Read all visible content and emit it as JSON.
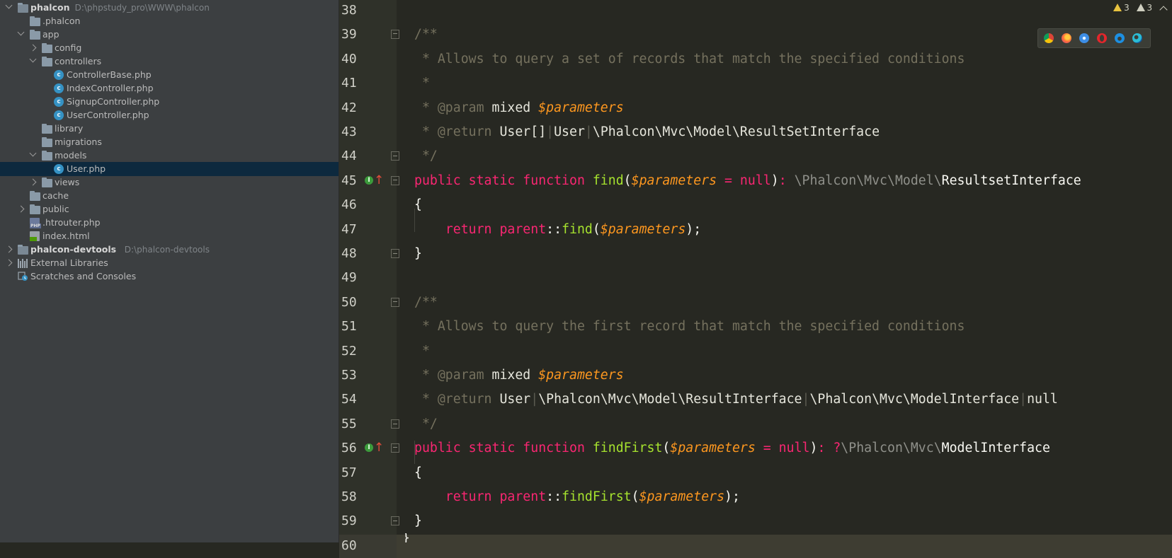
{
  "tree": {
    "items": [
      {
        "label": "phalcon",
        "path": "D:\\phpstudy_pro\\WWW\\phalcon",
        "icon": "folder-icon",
        "arrow": "down",
        "bold": true
      },
      {
        "label": ".phalcon",
        "icon": "folder-icon"
      },
      {
        "label": "app",
        "icon": "folder-icon",
        "arrow": "down"
      },
      {
        "label": "config",
        "icon": "folder-icon",
        "arrow": "right"
      },
      {
        "label": "controllers",
        "icon": "folder-icon",
        "arrow": "down"
      },
      {
        "label": "ControllerBase.php",
        "icon": "php-class-icon"
      },
      {
        "label": "IndexController.php",
        "icon": "php-class-icon"
      },
      {
        "label": "SignupController.php",
        "icon": "php-class-icon"
      },
      {
        "label": "UserController.php",
        "icon": "php-class-icon"
      },
      {
        "label": "library",
        "icon": "folder-icon"
      },
      {
        "label": "migrations",
        "icon": "folder-icon"
      },
      {
        "label": "models",
        "icon": "folder-icon",
        "arrow": "down"
      },
      {
        "label": "User.php",
        "icon": "php-class-icon",
        "selected": true
      },
      {
        "label": "views",
        "icon": "folder-icon",
        "arrow": "right"
      },
      {
        "label": "cache",
        "icon": "folder-icon"
      },
      {
        "label": "public",
        "icon": "folder-icon",
        "arrow": "right"
      },
      {
        "label": ".htrouter.php",
        "icon": "php-file-icon"
      },
      {
        "label": "index.html",
        "icon": "html-file-icon"
      },
      {
        "label": "phalcon-devtools",
        "path": "D:\\phalcon-devtools",
        "icon": "folder-icon",
        "arrow": "right",
        "bold": true
      },
      {
        "label": "External Libraries",
        "icon": "library-icon",
        "arrow": "right"
      },
      {
        "label": "Scratches and Consoles",
        "icon": "scratches-icon"
      }
    ]
  },
  "editor": {
    "warnings": [
      {
        "count": "3",
        "icon": "warning-icon"
      },
      {
        "count": "3",
        "icon": "weak-warning-icon"
      }
    ],
    "browsers": [
      "chrome-icon",
      "firefox-icon",
      "safari-icon",
      "opera-icon",
      "ie-icon",
      "edge-icon"
    ],
    "lines": [
      {
        "n": "38",
        "tokens": []
      },
      {
        "n": "39",
        "fold": "open",
        "tokens": [
          [
            "com",
            "/**"
          ]
        ]
      },
      {
        "n": "40",
        "tokens": [
          [
            "com",
            " * Allows to query a set of records that match the specified conditions"
          ]
        ]
      },
      {
        "n": "41",
        "tokens": [
          [
            "com",
            " *"
          ]
        ]
      },
      {
        "n": "42",
        "tokens": [
          [
            "com",
            " * @param "
          ],
          [
            "doc",
            "mixed "
          ],
          [
            "var",
            "$parameters"
          ]
        ]
      },
      {
        "n": "43",
        "tokens": [
          [
            "com",
            " * @return "
          ],
          [
            "doc",
            "User[]"
          ],
          [
            "sep",
            "|"
          ],
          [
            "doc",
            "User"
          ],
          [
            "sep",
            "|"
          ],
          [
            "doc",
            "\\Phalcon\\Mvc\\Model\\ResultSetInterface"
          ]
        ]
      },
      {
        "n": "44",
        "fold": "close",
        "tokens": [
          [
            "com",
            " */"
          ]
        ]
      },
      {
        "n": "45",
        "fold": "open",
        "override": true,
        "tokens": [
          [
            "kw",
            "public static function "
          ],
          [
            "fn",
            "find"
          ],
          [
            "txt",
            "("
          ],
          [
            "var",
            "$parameters"
          ],
          [
            "kw",
            " = null"
          ],
          [
            "txt",
            ")"
          ],
          [
            "kw",
            ": "
          ],
          [
            "ns",
            "\\Phalcon\\Mvc\\Model\\"
          ],
          [
            "txt",
            "ResultsetInterface"
          ]
        ]
      },
      {
        "n": "46",
        "tokens": [
          [
            "txt",
            "{"
          ]
        ]
      },
      {
        "n": "47",
        "tokens": [
          [
            "txt",
            "    "
          ],
          [
            "kw",
            "return parent"
          ],
          [
            "txt",
            "::"
          ],
          [
            "fn",
            "find"
          ],
          [
            "txt",
            "("
          ],
          [
            "var",
            "$parameters"
          ],
          [
            "txt",
            ");"
          ]
        ]
      },
      {
        "n": "48",
        "fold": "close",
        "tokens": [
          [
            "txt",
            "}"
          ]
        ]
      },
      {
        "n": "49",
        "tokens": []
      },
      {
        "n": "50",
        "fold": "open",
        "tokens": [
          [
            "com",
            "/**"
          ]
        ]
      },
      {
        "n": "51",
        "tokens": [
          [
            "com",
            " * Allows to query the first record that match the specified conditions"
          ]
        ]
      },
      {
        "n": "52",
        "tokens": [
          [
            "com",
            " *"
          ]
        ]
      },
      {
        "n": "53",
        "tokens": [
          [
            "com",
            " * @param "
          ],
          [
            "doc",
            "mixed "
          ],
          [
            "var",
            "$parameters"
          ]
        ]
      },
      {
        "n": "54",
        "tokens": [
          [
            "com",
            " * @return "
          ],
          [
            "doc",
            "User"
          ],
          [
            "sep",
            "|"
          ],
          [
            "doc",
            "\\Phalcon\\Mvc\\Model\\ResultInterface"
          ],
          [
            "sep",
            "|"
          ],
          [
            "doc",
            "\\Phalcon\\Mvc\\ModelInterface"
          ],
          [
            "sep",
            "|"
          ],
          [
            "doc",
            "null"
          ]
        ]
      },
      {
        "n": "55",
        "fold": "close",
        "tokens": [
          [
            "com",
            " */"
          ]
        ]
      },
      {
        "n": "56",
        "fold": "open",
        "override": true,
        "tokens": [
          [
            "kw",
            "public static function "
          ],
          [
            "fn",
            "findFirst"
          ],
          [
            "txt",
            "("
          ],
          [
            "var",
            "$parameters"
          ],
          [
            "kw",
            " = null"
          ],
          [
            "txt",
            ")"
          ],
          [
            "kw",
            ": ?"
          ],
          [
            "ns",
            "\\Phalcon\\Mvc\\"
          ],
          [
            "txt",
            "ModelInterface"
          ]
        ]
      },
      {
        "n": "57",
        "tokens": [
          [
            "txt",
            "{"
          ]
        ]
      },
      {
        "n": "58",
        "tokens": [
          [
            "txt",
            "    "
          ],
          [
            "kw",
            "return parent"
          ],
          [
            "txt",
            "::"
          ],
          [
            "fn",
            "findFirst"
          ],
          [
            "txt",
            "("
          ],
          [
            "var",
            "$parameters"
          ],
          [
            "txt",
            ");"
          ]
        ]
      },
      {
        "n": "59",
        "fold": "close",
        "tokens": [
          [
            "txt",
            "}"
          ]
        ]
      },
      {
        "n": "60",
        "current": true,
        "tokens": []
      }
    ],
    "trailing_text": "}"
  },
  "colors": {
    "editor_bg": "#272822",
    "tree_bg": "#3c3f41",
    "selection": "#0d293e",
    "keyword": "#f92672",
    "function": "#a6e22e",
    "variable": "#fd971f",
    "comment": "#75715e"
  }
}
